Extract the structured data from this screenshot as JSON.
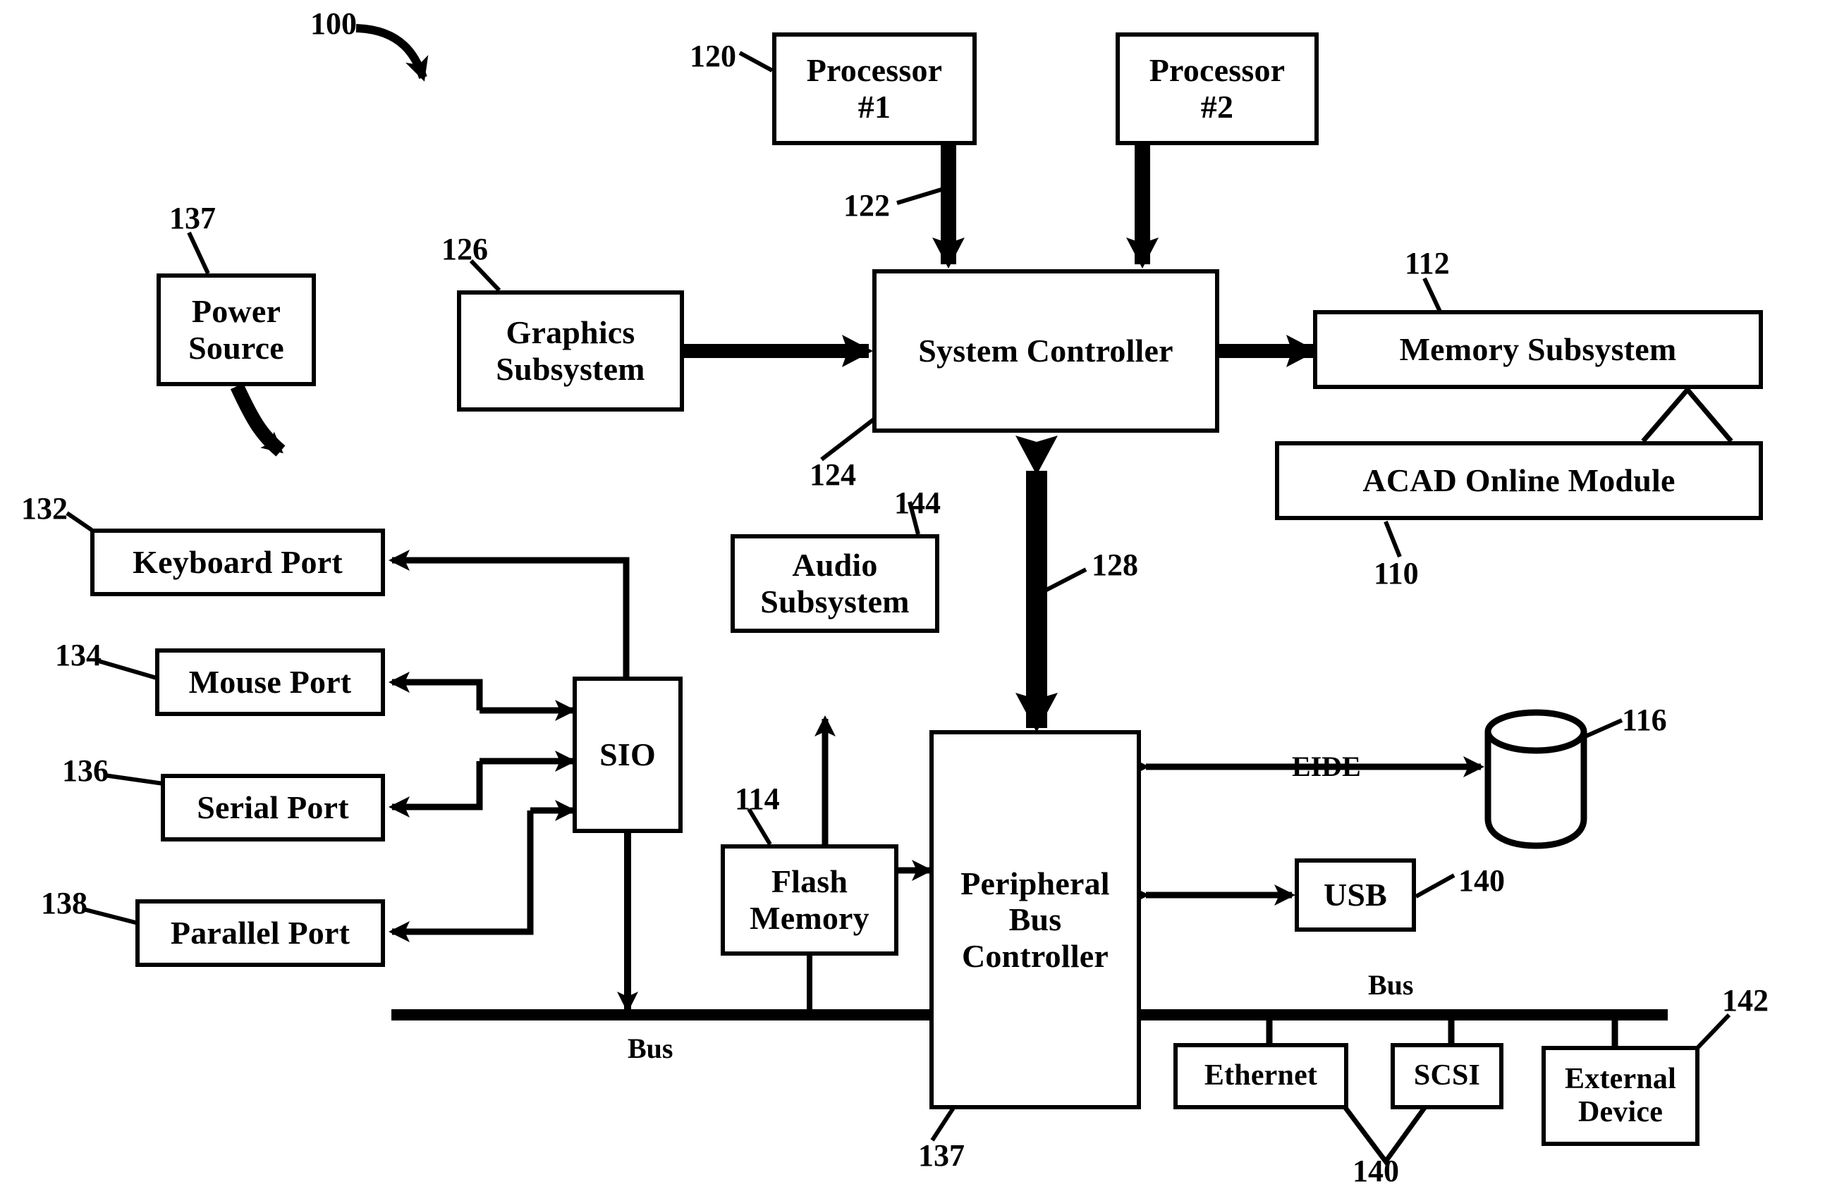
{
  "figure": {
    "figure_ref": "100",
    "bus_label_left": "Bus",
    "bus_label_right": "Bus",
    "eide_label": "EIDE"
  },
  "blocks": {
    "processor1": {
      "line1": "Processor",
      "line2": "#1",
      "ref": "120"
    },
    "processor2": {
      "line1": "Processor",
      "line2": "#2",
      "ref": ""
    },
    "system_controller": {
      "line1": "System Controller",
      "ref": "124"
    },
    "graphics_subsystem": {
      "line1": "Graphics",
      "line2": "Subsystem",
      "ref": "126"
    },
    "memory_subsystem": {
      "line1": "Memory Subsystem",
      "ref": "112"
    },
    "acad_online_module": {
      "line1": "ACAD Online Module",
      "ref": "110"
    },
    "power_source": {
      "line1": "Power",
      "line2": "Source",
      "ref": "137"
    },
    "keyboard_port": {
      "line1": "Keyboard Port",
      "ref": "132"
    },
    "mouse_port": {
      "line1": "Mouse Port",
      "ref": "134"
    },
    "serial_port": {
      "line1": "Serial Port",
      "ref": "136"
    },
    "parallel_port": {
      "line1": "Parallel Port",
      "ref": "138"
    },
    "sio": {
      "line1": "SIO",
      "ref": ""
    },
    "audio_subsystem": {
      "line1": "Audio",
      "line2": "Subsystem",
      "ref": "144"
    },
    "flash_memory": {
      "line1": "Flash",
      "line2": "Memory",
      "ref": "114"
    },
    "peripheral_bus_controller": {
      "line1": "Peripheral",
      "line2": "Bus",
      "line3": "Controller",
      "ref": "137"
    },
    "usb": {
      "line1": "USB",
      "ref": "140"
    },
    "ethernet": {
      "line1": "Ethernet",
      "ref": "140"
    },
    "scsi": {
      "line1": "SCSI",
      "ref": ""
    },
    "external_device": {
      "line1": "External",
      "line2": "Device",
      "ref": "142"
    },
    "disk_drive": {
      "line1": "",
      "ref": "116"
    }
  },
  "connector_refs": {
    "processor_bus": "122",
    "peripheral_bus_link": "128"
  },
  "colors": {
    "ink": "#000000",
    "paper": "#ffffff"
  }
}
